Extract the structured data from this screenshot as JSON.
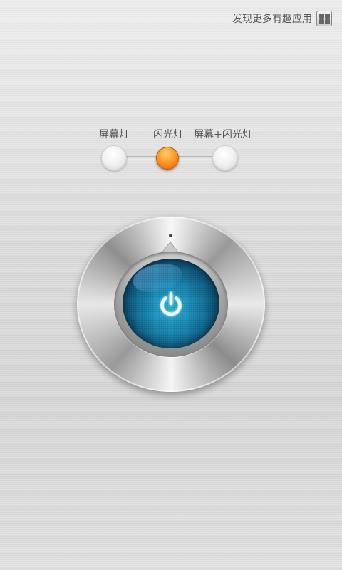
{
  "promo": {
    "label": "发现更多有趣应用",
    "icon": "apps-grid-icon"
  },
  "modes": {
    "items": [
      {
        "label": "屏幕灯",
        "selected": false
      },
      {
        "label": "闪光灯",
        "selected": true
      },
      {
        "label": "屏幕+闪光灯",
        "selected": false
      }
    ],
    "selected_color": "#f58a1f"
  },
  "power_button": {
    "icon": "power-icon",
    "glow_color": "#2fb3d8"
  }
}
